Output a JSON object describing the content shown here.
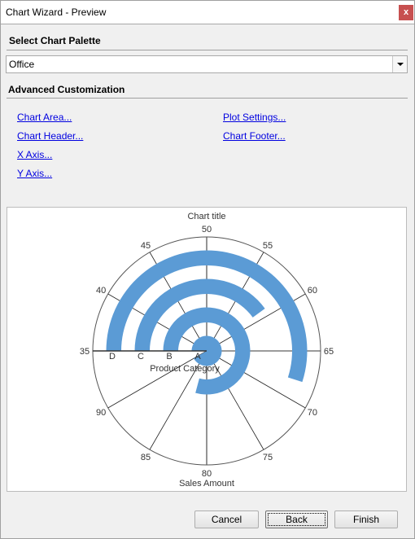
{
  "window": {
    "title": "Chart Wizard - Preview",
    "close_label": "x",
    "close_color": "#c75050"
  },
  "palette": {
    "heading": "Select Chart Palette",
    "selected": "Office"
  },
  "advanced": {
    "heading": "Advanced Customization",
    "left_links": [
      "Chart Area...",
      "Chart Header...",
      "X Axis...",
      "Y Axis..."
    ],
    "right_links": [
      "Plot Settings...",
      "Chart Footer..."
    ]
  },
  "buttons": {
    "cancel": "Cancel",
    "back": "Back",
    "finish": "Finish"
  },
  "icons": {
    "close": "close-x-icon",
    "dropdown": "chevron-down-icon"
  },
  "chart_data": {
    "type": "bar",
    "orientation": "radial",
    "title": "Chart title",
    "xlabel": "Product Category",
    "ylabel": "Sales Amount",
    "categories": [
      "A",
      "B",
      "C",
      "D"
    ],
    "values": [
      90,
      82.5,
      59,
      68
    ],
    "bar_color": "#5b9bd5",
    "ylim": [
      35,
      95
    ],
    "yticks": [
      35,
      40,
      45,
      50,
      55,
      60,
      65,
      70,
      75,
      80,
      85,
      90
    ],
    "value_start": "left",
    "direction": "clockwise",
    "grid": true,
    "legend": "none"
  }
}
